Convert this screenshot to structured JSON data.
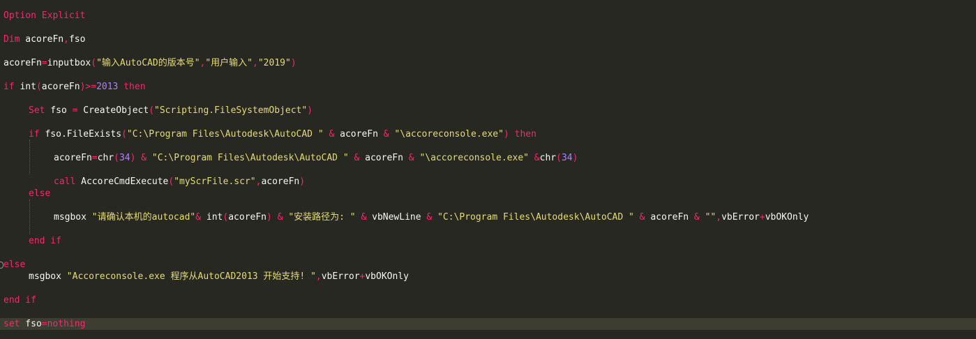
{
  "editor": {
    "lines": [
      {
        "indent": 0,
        "tokens": [
          {
            "t": "Option Explicit",
            "c": "kw"
          }
        ]
      },
      {
        "indent": 0,
        "tokens": [
          {
            "t": "Dim",
            "c": "kw"
          },
          {
            "t": " acoreFn",
            "c": "id"
          },
          {
            "t": ",",
            "c": "op"
          },
          {
            "t": "fso",
            "c": "id"
          }
        ]
      },
      {
        "indent": 0,
        "tokens": [
          {
            "t": "acoreFn",
            "c": "id"
          },
          {
            "t": "=",
            "c": "op"
          },
          {
            "t": "inputbox",
            "c": "id"
          },
          {
            "t": "(",
            "c": "op"
          },
          {
            "t": "\"输入AutoCAD的版本号\"",
            "c": "str"
          },
          {
            "t": ",",
            "c": "op"
          },
          {
            "t": "\"用户输入\"",
            "c": "str"
          },
          {
            "t": ",",
            "c": "op"
          },
          {
            "t": "\"2019\"",
            "c": "str"
          },
          {
            "t": ")",
            "c": "op"
          }
        ]
      },
      {
        "indent": 0,
        "tokens": [
          {
            "t": "if",
            "c": "kw"
          },
          {
            "t": " int",
            "c": "id"
          },
          {
            "t": "(",
            "c": "op"
          },
          {
            "t": "acoreFn",
            "c": "id"
          },
          {
            "t": ")>=",
            "c": "op"
          },
          {
            "t": "2013",
            "c": "num"
          },
          {
            "t": " then",
            "c": "kw"
          }
        ]
      },
      {
        "indent": 1,
        "tokens": [
          {
            "t": "Set",
            "c": "kw"
          },
          {
            "t": " fso ",
            "c": "id"
          },
          {
            "t": "=",
            "c": "op"
          },
          {
            "t": " CreateObject",
            "c": "id"
          },
          {
            "t": "(",
            "c": "op"
          },
          {
            "t": "\"Scripting.FileSystemObject\"",
            "c": "str"
          },
          {
            "t": ")",
            "c": "op"
          }
        ]
      },
      {
        "indent": 1,
        "tokens": [
          {
            "t": "if",
            "c": "kw"
          },
          {
            "t": " fso.FileExists",
            "c": "id"
          },
          {
            "t": "(",
            "c": "op"
          },
          {
            "t": "\"C:\\Program Files\\Autodesk\\AutoCAD \"",
            "c": "str"
          },
          {
            "t": " & ",
            "c": "op"
          },
          {
            "t": "acoreFn",
            "c": "id"
          },
          {
            "t": " & ",
            "c": "op"
          },
          {
            "t": "\"\\accoreconsole.exe\"",
            "c": "str"
          },
          {
            "t": ")",
            "c": "op"
          },
          {
            "t": " then",
            "c": "kw"
          }
        ]
      },
      {
        "indent": 2,
        "tokens": [
          {
            "t": "acoreFn",
            "c": "id"
          },
          {
            "t": "=",
            "c": "op"
          },
          {
            "t": "chr",
            "c": "id"
          },
          {
            "t": "(",
            "c": "op"
          },
          {
            "t": "34",
            "c": "num"
          },
          {
            "t": ")",
            "c": "op"
          },
          {
            "t": " & ",
            "c": "op"
          },
          {
            "t": "\"C:\\Program Files\\Autodesk\\AutoCAD \"",
            "c": "str"
          },
          {
            "t": " & ",
            "c": "op"
          },
          {
            "t": "acoreFn",
            "c": "id"
          },
          {
            "t": " & ",
            "c": "op"
          },
          {
            "t": "\"\\accoreconsole.exe\"",
            "c": "str"
          },
          {
            "t": " &",
            "c": "op"
          },
          {
            "t": "chr",
            "c": "id"
          },
          {
            "t": "(",
            "c": "op"
          },
          {
            "t": "34",
            "c": "num"
          },
          {
            "t": ")",
            "c": "op"
          }
        ]
      },
      {
        "indent": 2,
        "tokens": [
          {
            "t": "call",
            "c": "kw"
          },
          {
            "t": " AccoreCmdExecute",
            "c": "id"
          },
          {
            "t": "(",
            "c": "op"
          },
          {
            "t": "\"myScrFile.scr\"",
            "c": "str"
          },
          {
            "t": ",",
            "c": "op"
          },
          {
            "t": "acoreFn",
            "c": "id"
          },
          {
            "t": ")",
            "c": "op"
          }
        ]
      },
      {
        "indent": 1,
        "tokens": [
          {
            "t": "else",
            "c": "kw"
          }
        ]
      },
      {
        "indent": 2,
        "tokens": [
          {
            "t": "msgbox ",
            "c": "id"
          },
          {
            "t": "\"请确认本机的autocad\"",
            "c": "str"
          },
          {
            "t": "& ",
            "c": "op"
          },
          {
            "t": "int",
            "c": "id"
          },
          {
            "t": "(",
            "c": "op"
          },
          {
            "t": "acoreFn",
            "c": "id"
          },
          {
            "t": ")",
            "c": "op"
          },
          {
            "t": " & ",
            "c": "op"
          },
          {
            "t": "\"安装路径为: \"",
            "c": "str"
          },
          {
            "t": " & ",
            "c": "op"
          },
          {
            "t": "vbNewLine",
            "c": "id"
          },
          {
            "t": " & ",
            "c": "op"
          },
          {
            "t": "\"C:\\Program Files\\Autodesk\\AutoCAD \"",
            "c": "str"
          },
          {
            "t": " & ",
            "c": "op"
          },
          {
            "t": "acoreFn",
            "c": "id"
          },
          {
            "t": " & ",
            "c": "op"
          },
          {
            "t": "\"\"",
            "c": "str"
          },
          {
            "t": ",",
            "c": "op"
          },
          {
            "t": "vbError",
            "c": "id"
          },
          {
            "t": "+",
            "c": "op"
          },
          {
            "t": "vbOKOnly",
            "c": "id"
          }
        ]
      },
      {
        "indent": 1,
        "tokens": [
          {
            "t": "end if",
            "c": "kw"
          }
        ]
      },
      {
        "indent": 0,
        "tokens": [
          {
            "t": "else",
            "c": "kw"
          }
        ]
      },
      {
        "indent": 1,
        "tokens": [
          {
            "t": "msgbox ",
            "c": "id"
          },
          {
            "t": "\"Accoreconsole.exe 程序从AutoCAD2013 开始支持! \"",
            "c": "str"
          },
          {
            "t": ",",
            "c": "op"
          },
          {
            "t": "vbError",
            "c": "id"
          },
          {
            "t": "+",
            "c": "op"
          },
          {
            "t": "vbOKOnly",
            "c": "id"
          }
        ]
      },
      {
        "indent": 0,
        "tokens": [
          {
            "t": "end if",
            "c": "kw"
          }
        ]
      },
      {
        "indent": 0,
        "tokens": [
          {
            "t": "set",
            "c": "kw"
          },
          {
            "t": " fso",
            "c": "id"
          },
          {
            "t": "=",
            "c": "op"
          },
          {
            "t": "nothing",
            "c": "kw"
          }
        ]
      }
    ]
  }
}
